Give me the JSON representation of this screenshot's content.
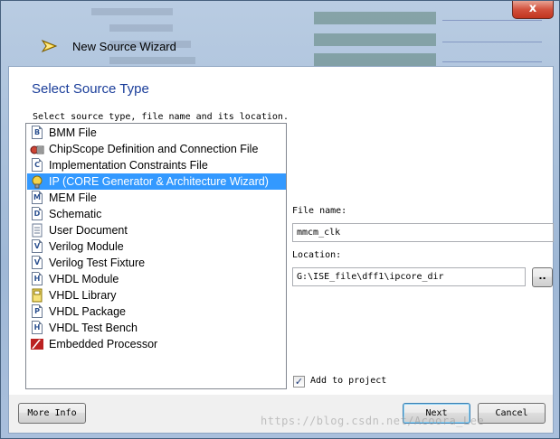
{
  "window": {
    "title": "New Source Wizard",
    "close_glyph": "x"
  },
  "page": {
    "section_title": "Select Source Type",
    "instructions": "Select source type, file name and its location."
  },
  "source_types": [
    {
      "label": "BMM File",
      "icon": "bmm-file-icon",
      "glyph": "B",
      "selected": false
    },
    {
      "label": "ChipScope Definition and Connection File",
      "icon": "chipscope-icon",
      "glyph": "",
      "selected": false
    },
    {
      "label": "Implementation Constraints File",
      "icon": "constraints-file-icon",
      "glyph": "C",
      "selected": false
    },
    {
      "label": "IP (CORE Generator & Architecture Wizard)",
      "icon": "ip-core-icon",
      "glyph": "",
      "selected": true
    },
    {
      "label": "MEM File",
      "icon": "mem-file-icon",
      "glyph": "M",
      "selected": false
    },
    {
      "label": "Schematic",
      "icon": "schematic-icon",
      "glyph": "D",
      "selected": false
    },
    {
      "label": "User Document",
      "icon": "user-document-icon",
      "glyph": "",
      "selected": false
    },
    {
      "label": "Verilog Module",
      "icon": "verilog-module-icon",
      "glyph": "V",
      "selected": false
    },
    {
      "label": "Verilog Test Fixture",
      "icon": "verilog-test-fixture-icon",
      "glyph": "V",
      "selected": false
    },
    {
      "label": "VHDL Module",
      "icon": "vhdl-module-icon",
      "glyph": "H",
      "selected": false
    },
    {
      "label": "VHDL Library",
      "icon": "vhdl-library-icon",
      "glyph": "",
      "selected": false
    },
    {
      "label": "VHDL Package",
      "icon": "vhdl-package-icon",
      "glyph": "P",
      "selected": false
    },
    {
      "label": "VHDL Test Bench",
      "icon": "vhdl-test-bench-icon",
      "glyph": "H",
      "selected": false
    },
    {
      "label": "Embedded Processor",
      "icon": "embedded-processor-icon",
      "glyph": "",
      "selected": false
    }
  ],
  "form": {
    "file_name_label": "File name:",
    "file_name_value": "mmcm_clk",
    "location_label": "Location:",
    "location_value": "G:\\ISE_file\\dff1\\ipcore_dir",
    "browse_label": "..",
    "add_to_project_label": "Add to project",
    "add_to_project_checked": true,
    "checkmark": "✓"
  },
  "buttons": {
    "more_info": "More Info",
    "next": "Next",
    "cancel": "Cancel"
  },
  "watermark": "https://blog.csdn.net/Acoora_Lee",
  "colors": {
    "selection": "#3399ff",
    "section_title": "#1b3e9a"
  }
}
